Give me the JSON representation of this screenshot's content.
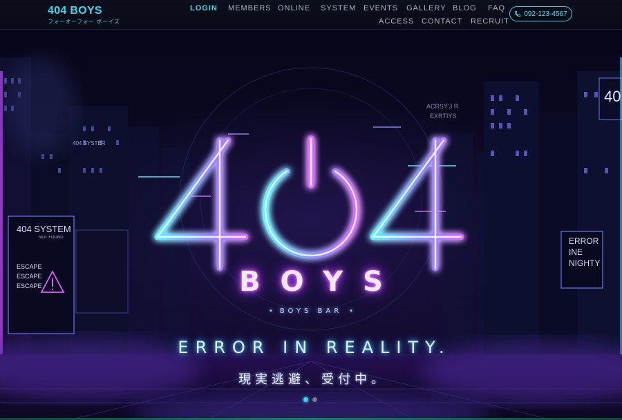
{
  "brand": {
    "name": "404 BOYS",
    "kana": "フォーオーフォー ボーイズ"
  },
  "nav": {
    "row1": [
      "LOGIN",
      "MEMBERS",
      "ONLINE",
      "SYSTEM",
      "EVENTS",
      "GALLERY",
      "BLOG",
      "FAQ"
    ],
    "row2": [
      "ACCESS",
      "CONTACT",
      "RECRUIT"
    ],
    "active": "LOGIN",
    "phone": "092-123-4567"
  },
  "hero": {
    "logo_text": "404",
    "name": "BOYS",
    "sub": "BOYS BAR",
    "tagline": "ERROR IN REALITY.",
    "subtagline": "現実逃避、受付中。",
    "signs": {
      "left_title": "404 SYSTEM",
      "left_small": "NOT FOUND",
      "left_lines": [
        "ESCAPE",
        "ESCAPE",
        "ESCAPE"
      ],
      "right_lines": [
        "ERROR",
        "INE",
        "NIGHTY"
      ],
      "top_right": "40",
      "mid_left": "404 SYSTER",
      "center_sign": [
        "ACRSY'J R",
        "EXRTIYS"
      ]
    },
    "slides": {
      "count": 2,
      "active": 1
    }
  },
  "colors": {
    "cyan": "#3fdcf0",
    "magenta": "#e36bff",
    "background": "#05040d"
  },
  "icons": {
    "phone": "phone-icon",
    "warning": "warning-triangle-icon",
    "power": "power-icon"
  }
}
